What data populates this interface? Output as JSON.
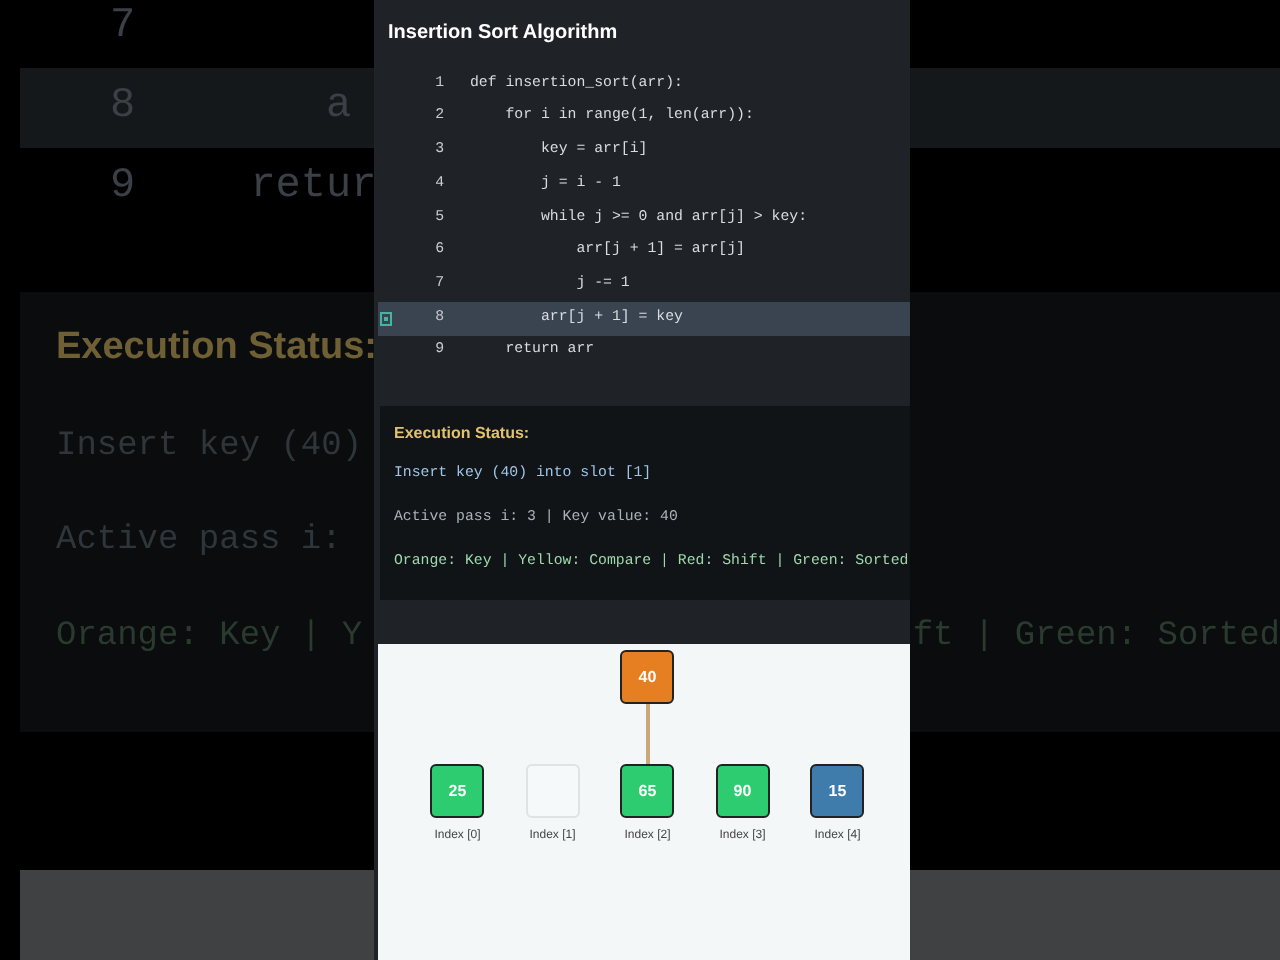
{
  "backdrop": {
    "code_rows": [
      {
        "number": "7",
        "selected": false
      },
      {
        "number": "8",
        "code": "     a",
        "selected": true
      },
      {
        "number": "9",
        "code": "  retur",
        "selected": false
      }
    ],
    "status_heading": "Execution Status:",
    "status_lines": [
      "Insert key (40)",
      "Active pass i:"
    ],
    "legend_left": "Orange: Key | Y",
    "legend_right": "ft | Green: Sorted"
  },
  "title": "Insertion Sort Algorithm",
  "code": [
    {
      "number": "1",
      "text": "def insertion_sort(arr):",
      "selected": false
    },
    {
      "number": "2",
      "text": "    for i in range(1, len(arr)):",
      "selected": false
    },
    {
      "number": "3",
      "text": "        key = arr[i]",
      "selected": false
    },
    {
      "number": "4",
      "text": "        j = i - 1",
      "selected": false
    },
    {
      "number": "5",
      "text": "        while j >= 0 and arr[j] > key:",
      "selected": false
    },
    {
      "number": "6",
      "text": "            arr[j + 1] = arr[j]",
      "selected": false
    },
    {
      "number": "7",
      "text": "            j -= 1",
      "selected": false
    },
    {
      "number": "8",
      "text": "        arr[j + 1] = key",
      "selected": true
    },
    {
      "number": "9",
      "text": "    return arr",
      "selected": false
    }
  ],
  "status": {
    "heading": "Execution Status:",
    "message": "Insert key (40) into slot [1]",
    "detail": "Active pass i: 3 | Key value: 40",
    "legend": "Orange: Key | Yellow: Compare | Red: Shift | Green: Sorted"
  },
  "array": {
    "key": {
      "value": "40",
      "color": "#e67e22"
    },
    "cells": [
      {
        "kind": "filled",
        "value": "25",
        "label": "Index [0]",
        "color": "#2ecc71",
        "under_key": false
      },
      {
        "kind": "empty",
        "label": "Index [1]",
        "under_key": false
      },
      {
        "kind": "filled",
        "value": "65",
        "label": "Index [2]",
        "color": "#2ecc71",
        "under_key": true
      },
      {
        "kind": "filled",
        "value": "90",
        "label": "Index [3]",
        "color": "#2ecc71",
        "under_key": false
      },
      {
        "kind": "filled",
        "value": "15",
        "label": "Index [4]",
        "color": "#3f7cac",
        "under_key": false
      }
    ]
  }
}
